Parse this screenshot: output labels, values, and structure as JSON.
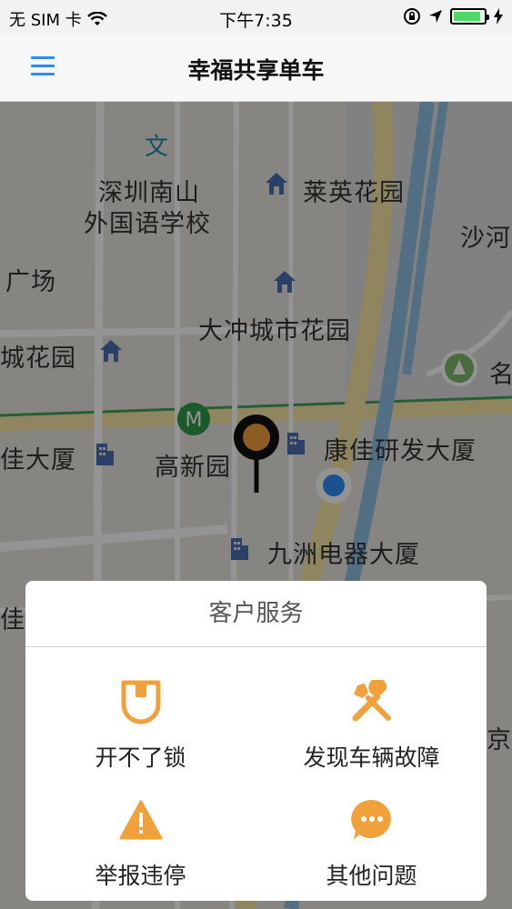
{
  "status_bar": {
    "carrier": "无 SIM 卡",
    "time": "下午7:35",
    "battery_level": 0.9
  },
  "nav": {
    "title": "幸福共享单车",
    "menu_icon": "hamburger-menu-icon"
  },
  "map": {
    "labels": [
      "深圳南山",
      "外国语学校",
      "莱英花园",
      "沙河",
      "广场",
      "大冲城市花园",
      "城花园",
      "名",
      "佳大厦",
      "高新园",
      "康佳研发大厦",
      "九洲电器大厦",
      "佳",
      "京"
    ]
  },
  "dialog": {
    "title": "客户服务",
    "options": [
      {
        "label": "开不了锁",
        "icon": "lock-icon"
      },
      {
        "label": "发现车辆故障",
        "icon": "tools-icon"
      },
      {
        "label": "举报违停",
        "icon": "warning-icon"
      },
      {
        "label": "其他问题",
        "icon": "chat-bubble-icon"
      }
    ],
    "accent_color": "#f0a13c"
  }
}
